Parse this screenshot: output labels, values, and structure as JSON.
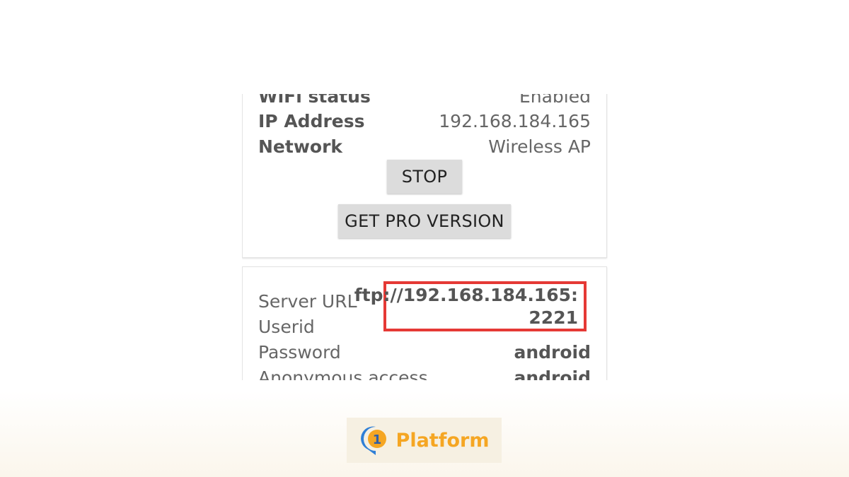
{
  "status_card": {
    "rows": [
      {
        "label": "WiFi status",
        "value": "Enabled"
      },
      {
        "label": "IP Address",
        "value": "192.168.184.165"
      },
      {
        "label": "Network",
        "value": "Wireless AP"
      }
    ],
    "stop_label": "STOP",
    "pro_label": "GET PRO VERSION"
  },
  "server_card": {
    "rows": [
      {
        "label": "Server URL"
      },
      {
        "label": "Userid"
      },
      {
        "label": "Password",
        "value": "android"
      },
      {
        "label": "Anonymous access",
        "value": "android"
      }
    ],
    "server_url_line1": "ftp://192.168.184.165:",
    "server_url_line2": "2221"
  },
  "watermark": {
    "brand": "Platform",
    "badge_digit": "1"
  },
  "colors": {
    "highlight": "#e53935",
    "brand": "#f5a623",
    "brand_blue": "#2f7fd6"
  }
}
